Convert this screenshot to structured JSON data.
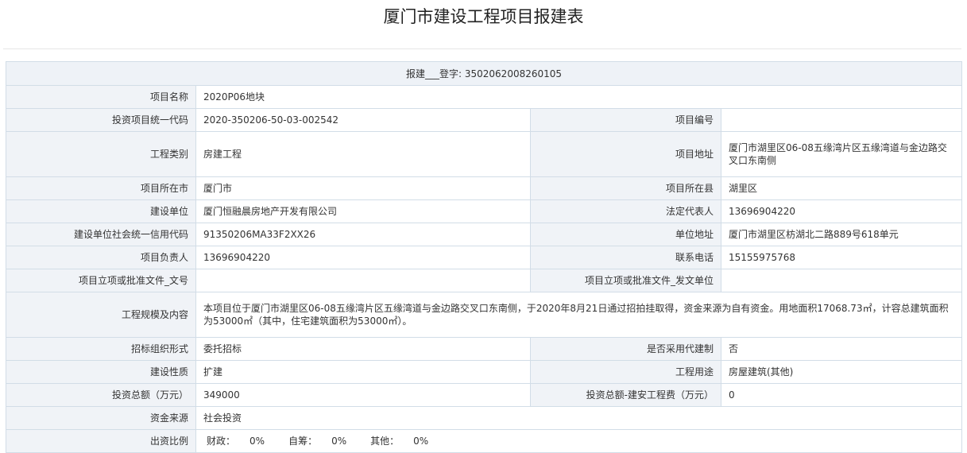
{
  "page": {
    "title": "厦门市建设工程项目报建表"
  },
  "registration": {
    "label": "报建___登字:",
    "number": "3502062008260105"
  },
  "fields": {
    "project_name": {
      "label": "项目名称",
      "value": "2020P06地块"
    },
    "invest_code": {
      "label": "投资项目统一代码",
      "value": "2020-350206-50-03-002542"
    },
    "project_no": {
      "label": "项目编号",
      "value": ""
    },
    "project_type": {
      "label": "工程类别",
      "value": "房建工程"
    },
    "project_address": {
      "label": "项目地址",
      "value": "厦门市湖里区06-08五缘湾片区五缘湾道与金边路交叉口东南侧"
    },
    "city": {
      "label": "项目所在市",
      "value": "厦门市"
    },
    "county": {
      "label": "项目所在县",
      "value": "湖里区"
    },
    "builder": {
      "label": "建设单位",
      "value": "厦门恒融晨房地产开发有限公司"
    },
    "legal_rep": {
      "label": "法定代表人",
      "value": "13696904220"
    },
    "credit_code": {
      "label": "建设单位社会统一信用代码",
      "value": "91350206MA33F2XX26"
    },
    "unit_address": {
      "label": "单位地址",
      "value": "厦门市湖里区枋湖北二路889号618单元"
    },
    "project_leader": {
      "label": "项目负责人",
      "value": "13696904220"
    },
    "phone": {
      "label": "联系电话",
      "value": "15155975768"
    },
    "approval_doc_no": {
      "label": "项目立项或批准文件_文号",
      "value": ""
    },
    "approval_issuer": {
      "label": "项目立项或批准文件_发文单位",
      "value": ""
    },
    "scale": {
      "label": "工程规模及内容",
      "value": "本项目位于厦门市湖里区06-08五缘湾片区五缘湾道与金边路交叉口东南侧，于2020年8月21日通过招拍挂取得，资金来源为自有资金。用地面积17068.73㎡，计容总建筑面积为53000㎡（其中，住宅建筑面积为53000㎡）。"
    },
    "bid_form": {
      "label": "招标组织形式",
      "value": "委托招标"
    },
    "agent_system": {
      "label": "是否采用代建制",
      "value": "否"
    },
    "nature": {
      "label": "建设性质",
      "value": "扩建"
    },
    "usage": {
      "label": "工程用途",
      "value": "房屋建筑(其他)"
    },
    "total_invest": {
      "label": "投资总额（万元）",
      "value": "349000"
    },
    "install_cost": {
      "label": "投资总额-建安工程费（万元）",
      "value": "0"
    },
    "fund_source": {
      "label": "资金来源",
      "value": "社会投资"
    },
    "fund_ratio": {
      "label": "出资比例",
      "fiscal_label": "财政：",
      "fiscal_value": "0%",
      "self_label": "自筹：",
      "self_value": "0%",
      "other_label": "其他：",
      "other_value": "0%"
    }
  }
}
